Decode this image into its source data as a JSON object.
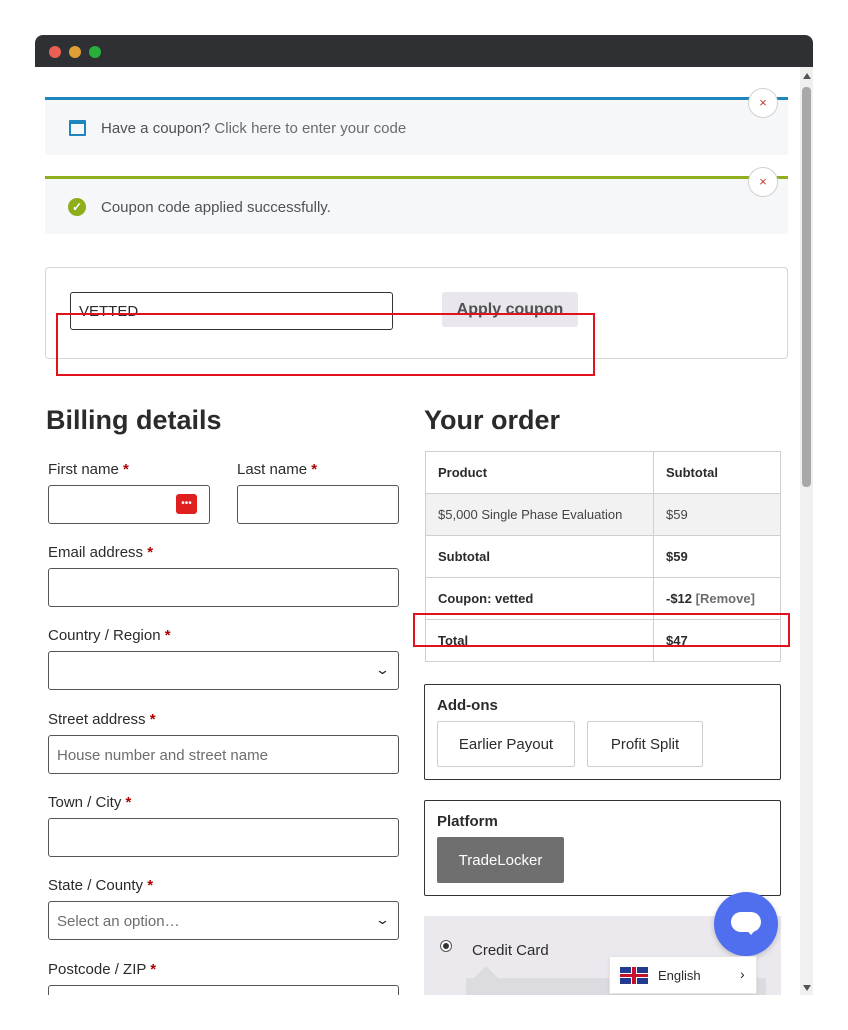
{
  "notices": {
    "coupon_prompt_text": "Have a coupon?",
    "coupon_prompt_link": "Click here to enter your code",
    "success_text": "Coupon code applied successfully.",
    "close_symbol": "×"
  },
  "coupon_form": {
    "code_value": "VETTED",
    "apply_label": "Apply coupon"
  },
  "billing": {
    "title": "Billing details",
    "required_mark": "*",
    "first_name_label": "First name",
    "last_name_label": "Last name",
    "email_label": "Email address",
    "country_label": "Country / Region",
    "street_label": "Street address",
    "street_placeholder": "House number and street name",
    "city_label": "Town / City",
    "state_label": "State / County",
    "state_placeholder": "Select an option…",
    "postcode_label": "Postcode / ZIP",
    "autofill_icon_text": "•••"
  },
  "order": {
    "title": "Your order",
    "header": [
      "Product",
      "Subtotal"
    ],
    "product_name": "$5,000 Single Phase Evaluation",
    "product_price": "$59",
    "subtotal_label": "Subtotal",
    "subtotal_value": "$59",
    "coupon_label": "Coupon: vetted",
    "coupon_value": "-$12",
    "coupon_remove": "[Remove]",
    "total_label": "Total",
    "total_value": "$47"
  },
  "addons": {
    "title": "Add-ons",
    "options": [
      "Earlier Payout",
      "Profit Split"
    ]
  },
  "platform": {
    "title": "Platform",
    "selected": "TradeLocker"
  },
  "payment": {
    "method_label": "Credit Card"
  },
  "language": {
    "label": "English",
    "chevron": "›"
  },
  "colors": {
    "info_accent": "#1e85be",
    "success_accent": "#8fae1b",
    "highlight_red": "#e0121b",
    "chat_blue": "#4f6fef"
  }
}
